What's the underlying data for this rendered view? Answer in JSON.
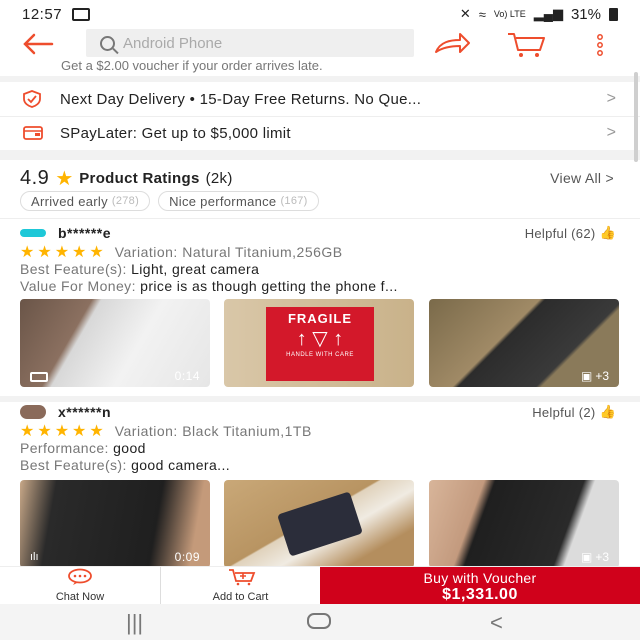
{
  "status_bar": {
    "time": "12:57",
    "battery": "31%",
    "net": "Vo) LTE"
  },
  "search": {
    "placeholder": "Android Phone"
  },
  "voucher_note": "Get a $2.00 voucher if your order arrives late.",
  "delivery": {
    "label": "Next Day Delivery  •  15-Day Free Returns. No Que..."
  },
  "paylater": {
    "label": "SPayLater: Get up to $5,000 limit"
  },
  "ratings": {
    "score": "4.9",
    "title": "Product Ratings",
    "count": "(2k)",
    "view_all": "View All",
    "chips": [
      {
        "label": "Arrived early",
        "count": "(278)"
      },
      {
        "label": "Nice performance",
        "count": "(167)"
      }
    ]
  },
  "reviews": [
    {
      "user": "b******e",
      "helpful": "Helpful (62)",
      "stars": "★★★★★",
      "variation": "Variation: Natural Titanium,256GB",
      "lines": [
        {
          "k": "Best Feature(s): ",
          "v": "Light, great camera"
        },
        {
          "k": "Value For Money: ",
          "v": "price is as though getting the phone f..."
        }
      ],
      "media": [
        {
          "tag": "0:14"
        },
        {
          "tag": ""
        },
        {
          "tag": "+3"
        }
      ]
    },
    {
      "user": "x******n",
      "helpful": "Helpful (2)",
      "stars": "★★★★★",
      "variation": "Variation: Black Titanium,1TB",
      "lines": [
        {
          "k": "Performance: ",
          "v": "good"
        },
        {
          "k": "Best Feature(s): ",
          "v": "good camera..."
        }
      ],
      "media": [
        {
          "tag": "0:09"
        },
        {
          "tag": ""
        },
        {
          "tag": "+3"
        }
      ]
    }
  ],
  "fragile": {
    "title": "FRAGILE",
    "sub": "HANDLE WITH CARE"
  },
  "actions": {
    "chat": "Chat Now",
    "cart": "Add to Cart",
    "buy_line1": "Buy with Voucher",
    "buy_line2": "$1,331.00"
  },
  "colors": {
    "accent": "#ee4d2d",
    "buy": "#d0011b",
    "star": "#ffb400"
  }
}
